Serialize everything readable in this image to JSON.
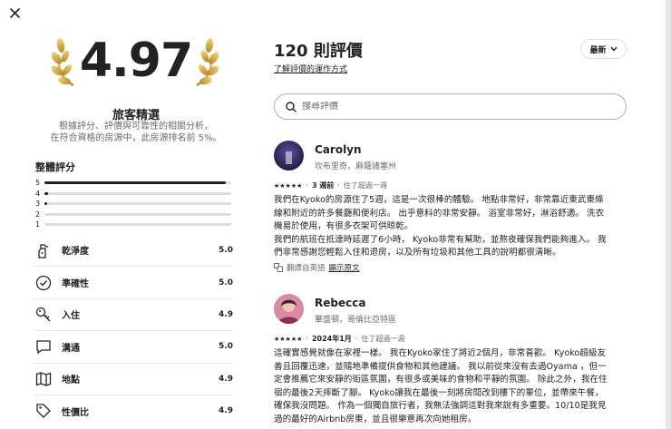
{
  "header": {
    "close_icon": "close-icon"
  },
  "summary": {
    "score": "4.97",
    "badge_title": "旅客精選",
    "badge_desc_line1": "根據評分、評價與可靠性的相關分析，",
    "badge_desc_line2": "在符合資格的房源中，此房源排名前 5%。",
    "overall_title": "整體評分",
    "distribution": [
      {
        "stars": "5",
        "fraction": 0.97
      },
      {
        "stars": "4",
        "fraction": 0.02
      },
      {
        "stars": "3",
        "fraction": 0.01
      },
      {
        "stars": "2",
        "fraction": 0.0
      },
      {
        "stars": "1",
        "fraction": 0.0
      }
    ],
    "categories": [
      {
        "label": "乾淨度",
        "score": "5.0",
        "icon": "spray-bottle-icon"
      },
      {
        "label": "準確性",
        "score": "5.0",
        "icon": "check-circle-icon"
      },
      {
        "label": "入住",
        "score": "4.9",
        "icon": "key-icon"
      },
      {
        "label": "溝通",
        "score": "5.0",
        "icon": "chat-bubble-icon"
      },
      {
        "label": "地點",
        "score": "4.9",
        "icon": "map-icon"
      },
      {
        "label": "性價比",
        "score": "4.9",
        "icon": "price-tag-icon"
      }
    ]
  },
  "reviews_header": {
    "count_title": "120 則評價",
    "how_link": "了解評價的運作方式",
    "sort_label": "最新",
    "search_placeholder": "搜尋評價"
  },
  "reviews": [
    {
      "name": "Carolyn",
      "location": "坎布里奇，麻薩諸塞州",
      "stars": "★★★★★",
      "date": "3 週前",
      "stay": "住了超過一週",
      "text_lines": [
        "我們在Kyoko的房源住了5週，這是一次很棒的體驗。 地點非常好，非常靠近東武東條",
        "線和附近的許多餐廳和便利店。 出乎意料的非常安靜。 浴室非常好，淋浴舒適。 洗衣",
        "機易於使用，有很多衣架可供晾乾。",
        "我們的航班在抵達時延遲了6小時， Kyoko非常有幫助，並熬夜確保我們能夠進入。 我",
        "們非常感謝您輕鬆入住和退房，以及所有垃圾和其他工具的說明都很清晰。"
      ],
      "translated_label": "翻譯自英語",
      "original_link": "顯示原文"
    },
    {
      "name": "Rebecca",
      "location": "華盛頓，哥倫比亞特區",
      "stars": "★★★★★",
      "date": "2024年1月",
      "stay": "住了超過一週",
      "text_lines": [
        "這確實感覺就像在家裡一樣。 我在Kyoko家住了將近2個月，非常喜歡。 Kyoko超級友",
        "善且回覆迅速，並隨地準備提供食物和其他建議。 我以前從來沒有去過Oyama ，但一",
        "定會推薦它來安靜的街區氛圍，有很多或美味的食物和平靜的氛圍。 除此之外，我在住",
        "宿的最後2天摔斷了腳。 Kyoko讓我在最後一刻將房間改到樓下的單位，並帶來午餐，",
        "確保我沒問題。 作為一個獨自旅行者，我無法強調這對我來說有多重要。10/10是我見",
        "過的最好的Airbnb房東，並且很樂意再次向她租房。"
      ]
    }
  ]
}
